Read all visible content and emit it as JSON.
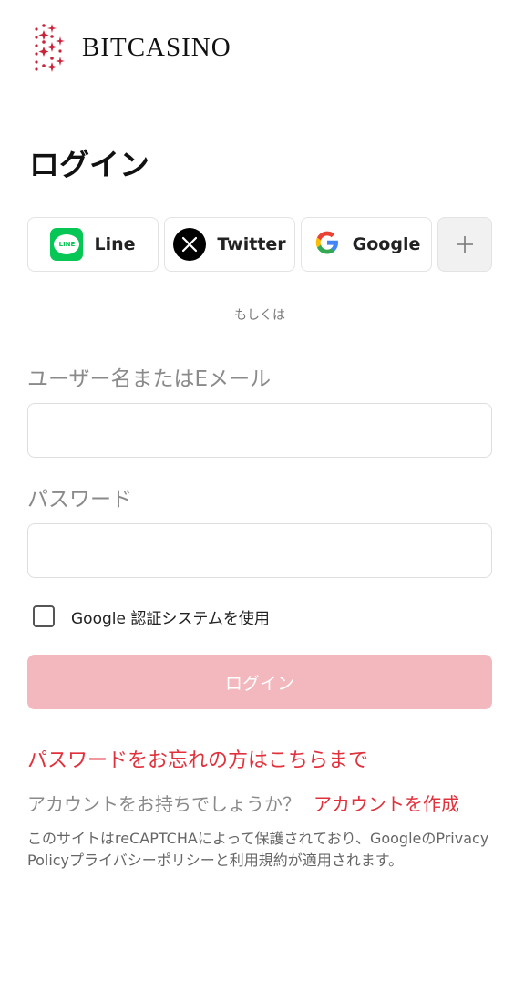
{
  "brand": {
    "name": "BITCASINO",
    "accent_color": "#e0313c"
  },
  "page": {
    "title": "ログイン"
  },
  "social": [
    {
      "label": "Line",
      "icon": "line-icon"
    },
    {
      "label": "Twitter",
      "icon": "x-icon"
    },
    {
      "label": "Google",
      "icon": "google-icon"
    }
  ],
  "more_icon": "plus-icon",
  "divider_text": "もしくは",
  "form": {
    "username_label": "ユーザー名またはEメール",
    "username_value": "",
    "password_label": "パスワード",
    "password_value": "",
    "twofa_label": "Google 認証システムを使用",
    "submit_label": "ログイン"
  },
  "links": {
    "forgot_password": "パスワードをお忘れの方はこちらまで",
    "no_account": "アカウントをお持ちでしょうか？",
    "create_account": "アカウントを作成"
  },
  "recaptcha_notice": "このサイトはreCAPTCHAによって保護されており、GoogleのPrivacy Policyプライバシーポリシーと利用規約が適用されます。"
}
